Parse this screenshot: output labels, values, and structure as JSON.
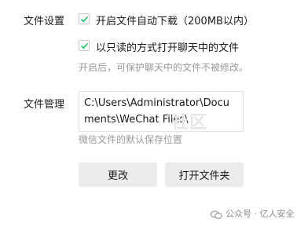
{
  "file_settings": {
    "label": "文件设置",
    "option_auto_download": "开启文件自动下载（200MB以内）",
    "option_readonly": "以只读的方式打开聊天中的文件",
    "readonly_hint": "开启后，可保护聊天中的文件不被修改。"
  },
  "file_management": {
    "label": "文件管理",
    "path": "C:\\Users\\Administrator\\Documents\\WeChat Files\\",
    "path_hint": "微信文件的默认保存位置",
    "change_button": "更改",
    "open_folder_button": "打开文件夹"
  },
  "watermark": "社区",
  "footer": {
    "account": "公众号 · 亿人安全"
  },
  "colors": {
    "check": "#07c160"
  }
}
